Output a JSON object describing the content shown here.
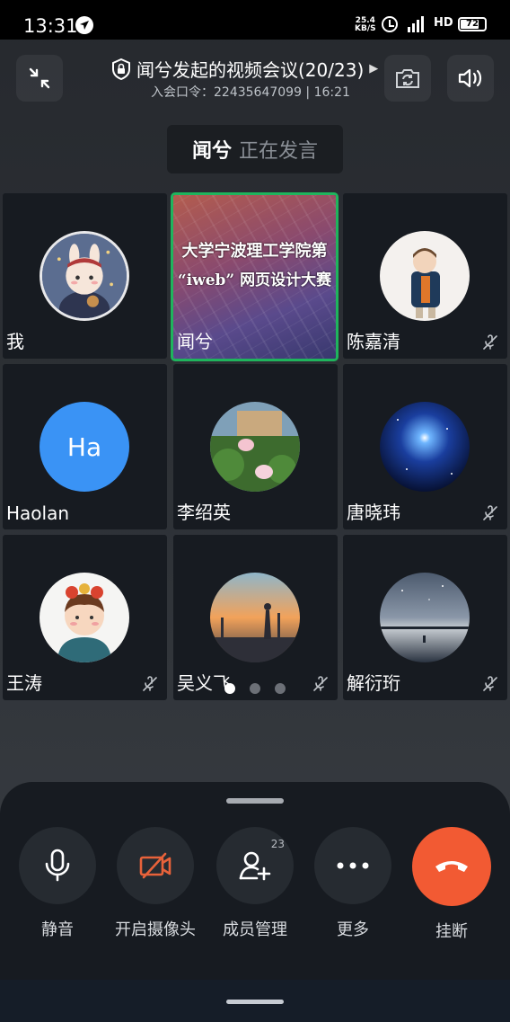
{
  "status_bar": {
    "time": "13:31",
    "net_speed_value": "25.4",
    "net_speed_unit": "KB/S",
    "signal_label": "4G",
    "hd_label": "HD",
    "battery": "72"
  },
  "header": {
    "title": "闻兮发起的视频会议(20/23)",
    "subtitle": "入会口令：22435647099 | 16:21"
  },
  "speaker": {
    "name": "闻兮",
    "status": "正在发言"
  },
  "shared_screen": {
    "line1": "大学宁波理工学院第",
    "line2": "“iweb” 网页设计大赛"
  },
  "participants": [
    {
      "name": "我",
      "muted": false,
      "avatar": "anime-avatar"
    },
    {
      "name": "闻兮",
      "muted": false,
      "avatar": "screen-share",
      "active": true
    },
    {
      "name": "陈嘉清",
      "muted": true,
      "avatar": "child-photo"
    },
    {
      "name": "Haolan",
      "muted": false,
      "avatar": "initials",
      "initials": "Ha"
    },
    {
      "name": "李绍英",
      "muted": false,
      "avatar": "lotus-photo"
    },
    {
      "name": "唐晓玮",
      "muted": true,
      "avatar": "galaxy-photo"
    },
    {
      "name": "王涛",
      "muted": true,
      "avatar": "cartoon-boy"
    },
    {
      "name": "吴义飞",
      "muted": true,
      "avatar": "sunset-illustration"
    },
    {
      "name": "解衍珩",
      "muted": true,
      "avatar": "starry-lake"
    }
  ],
  "pagination": {
    "current": 1,
    "total": 3
  },
  "controls": {
    "mute": "静音",
    "camera": "开启摄像头",
    "members": "成员管理",
    "members_count": "23",
    "more": "更多",
    "hangup": "挂断"
  },
  "colors": {
    "active_border": "#1fb45d",
    "hangup": "#f25a33",
    "camera_icon": "#e8623a",
    "initials_avatar": "#3a93f5"
  }
}
